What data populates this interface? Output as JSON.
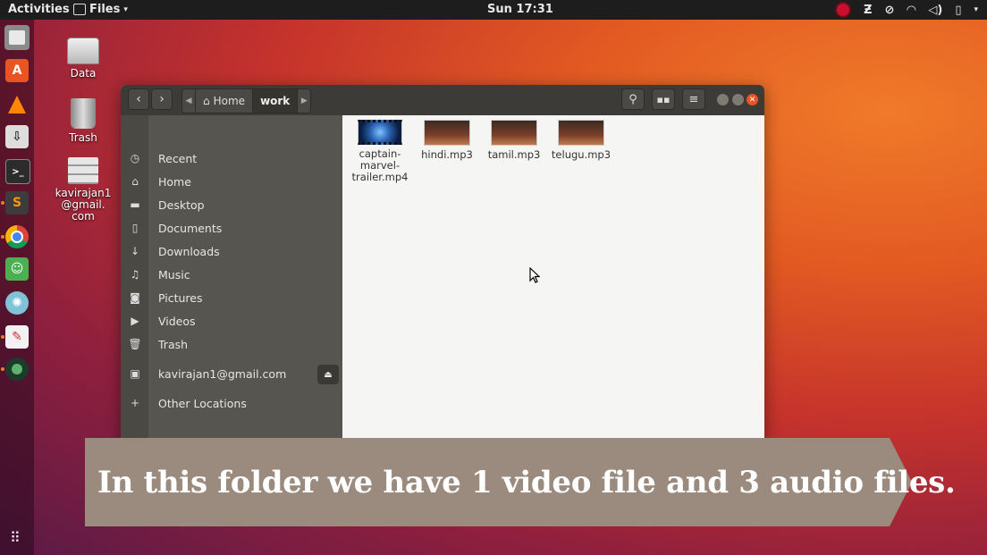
{
  "topbar": {
    "activities": "Activities",
    "app_menu": "Files",
    "clock": "Sun 17:31"
  },
  "desktop": {
    "icons": [
      {
        "label": "Data"
      },
      {
        "label": "Trash"
      },
      {
        "label": "kavirajan1@gmail.com",
        "lines": [
          "kavirajan1",
          "@gmail.",
          "com"
        ]
      }
    ]
  },
  "window": {
    "breadcrumbs": {
      "home": "Home",
      "current": "work"
    },
    "sidebar": {
      "items": [
        {
          "label": "Recent",
          "icon": "clock-icon"
        },
        {
          "label": "Home",
          "icon": "home-icon"
        },
        {
          "label": "Desktop",
          "icon": "folder-icon"
        },
        {
          "label": "Documents",
          "icon": "document-icon"
        },
        {
          "label": "Downloads",
          "icon": "download-icon"
        },
        {
          "label": "Music",
          "icon": "music-icon"
        },
        {
          "label": "Pictures",
          "icon": "camera-icon"
        },
        {
          "label": "Videos",
          "icon": "video-icon"
        },
        {
          "label": "Trash",
          "icon": "trash-icon"
        }
      ],
      "device": "kavirajan1@gmail.com",
      "other": "Other Locations"
    },
    "files": [
      {
        "name": "captain-marvel-trailer.mp4",
        "lines": [
          "captain-",
          "marvel-",
          "trailer.mp4"
        ],
        "type": "video"
      },
      {
        "name": "hindi.mp3",
        "type": "audio"
      },
      {
        "name": "tamil.mp3",
        "type": "audio"
      },
      {
        "name": "telugu.mp3",
        "type": "audio"
      }
    ]
  },
  "caption": "In this folder we have 1 video file and 3 audio files.",
  "colors": {
    "accent": "#e95420",
    "banner": "#9a8b7e"
  }
}
